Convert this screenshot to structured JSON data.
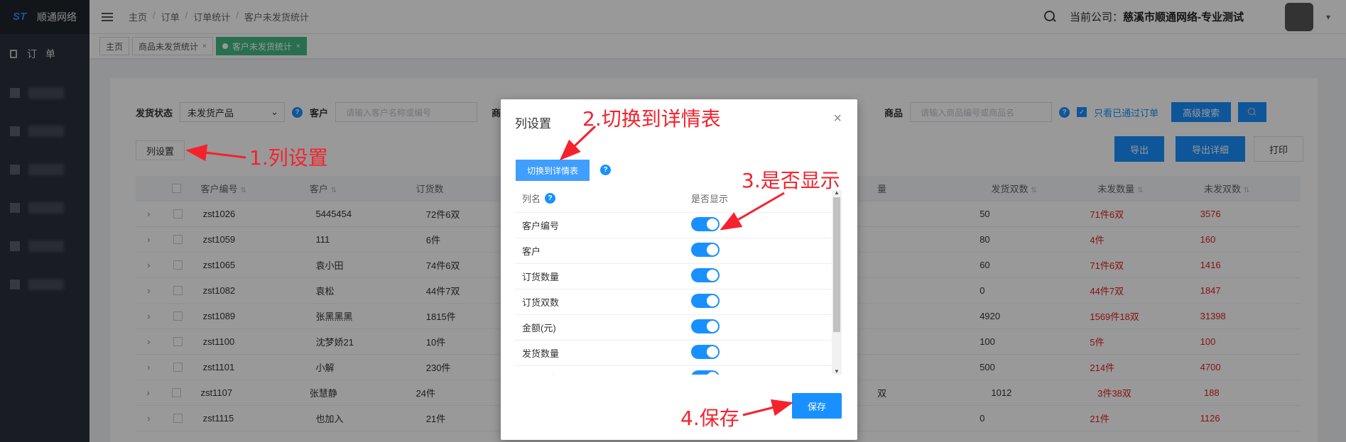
{
  "sidebar": {
    "logo_text": "顺通网络",
    "menu_title": "订 单"
  },
  "header": {
    "breadcrumb": [
      "主页",
      "订单",
      "订单统计",
      "客户未发货统计"
    ],
    "company_label": "当前公司：",
    "company_name": "慈溪市顺通网络-专业测试"
  },
  "tabs": [
    {
      "label": "主页"
    },
    {
      "label": "商品未发货统计"
    },
    {
      "label": "客户未发货统计",
      "active": true
    }
  ],
  "filters": {
    "status_label": "发货状态",
    "status_value": "未发货产品",
    "customer_label": "客户",
    "customer_placeholder": "请输入客户名称或编号",
    "product_label": "商品",
    "product_placeholder": "请输入商品编号或商品名",
    "approved_only": "只看已通过订单",
    "advanced_search": "高级搜索",
    "column_settings": "列设置",
    "export": "导出",
    "export_detail": "导出详细",
    "print": "打印"
  },
  "table": {
    "headers": [
      "客户编号",
      "客户",
      "订货数",
      "发货双数",
      "未发数量",
      "未发双数"
    ],
    "rows": [
      {
        "code": "zst1026",
        "customer": "5445454",
        "order": "72件6双",
        "shipped_pairs": "50",
        "unshipped_qty": "71件6双",
        "unshipped_pairs": "3576"
      },
      {
        "code": "zst1059",
        "customer": "111",
        "order": "6件",
        "shipped_pairs": "80",
        "unshipped_qty": "4件",
        "unshipped_pairs": "160"
      },
      {
        "code": "zst1065",
        "customer": "袁小田",
        "order": "74件6双",
        "shipped_pairs": "60",
        "unshipped_qty": "71件6双",
        "unshipped_pairs": "1416"
      },
      {
        "code": "zst1082",
        "customer": "袁松",
        "order": "44件7双",
        "shipped_pairs": "0",
        "unshipped_qty": "44件7双",
        "unshipped_pairs": "1847"
      },
      {
        "code": "zst1089",
        "customer": "张黑黑黑",
        "order": "1815件",
        "shipped_pairs": "4920",
        "unshipped_qty": "1569件18双",
        "unshipped_pairs": "31398"
      },
      {
        "code": "zst1100",
        "customer": "沈梦娇21",
        "order": "10件",
        "shipped_pairs": "100",
        "unshipped_qty": "5件",
        "unshipped_pairs": "100"
      },
      {
        "code": "zst1101",
        "customer": "小解",
        "order": "230件",
        "shipped_pairs": "500",
        "unshipped_qty": "214件",
        "unshipped_pairs": "4700"
      },
      {
        "code": "zst1107",
        "customer": "张慧静",
        "order": "24件",
        "shipped_pairs": "1012",
        "unshipped_qty": "3件38双",
        "unshipped_pairs": "188"
      },
      {
        "code": "zst1115",
        "customer": "也加入",
        "order": "21件",
        "shipped_pairs": "0",
        "unshipped_qty": "21件",
        "unshipped_pairs": "1126"
      }
    ],
    "partial_cells": [
      "量",
      "双"
    ]
  },
  "modal": {
    "title": "列设置",
    "switch_button": "切换到详情表",
    "col_name_header": "列名",
    "show_header": "是否显示",
    "rows": [
      {
        "name": "客户编号",
        "on": true
      },
      {
        "name": "客户",
        "on": true
      },
      {
        "name": "订货数量",
        "on": true
      },
      {
        "name": "订货双数",
        "on": true
      },
      {
        "name": "金额(元)",
        "on": true
      },
      {
        "name": "发货数量",
        "on": true
      },
      {
        "name": "发货双数",
        "on": true
      }
    ],
    "save": "保存"
  },
  "annotations": {
    "a1": "1.列设置",
    "a2": "2.切换到详情表",
    "a3": "3.是否显示",
    "a4": "4.保存"
  },
  "colors": {
    "accent": "#1890ff",
    "annotation": "#f5222d",
    "active_tab": "#42b983",
    "sidebar": "#2b2f3a"
  }
}
